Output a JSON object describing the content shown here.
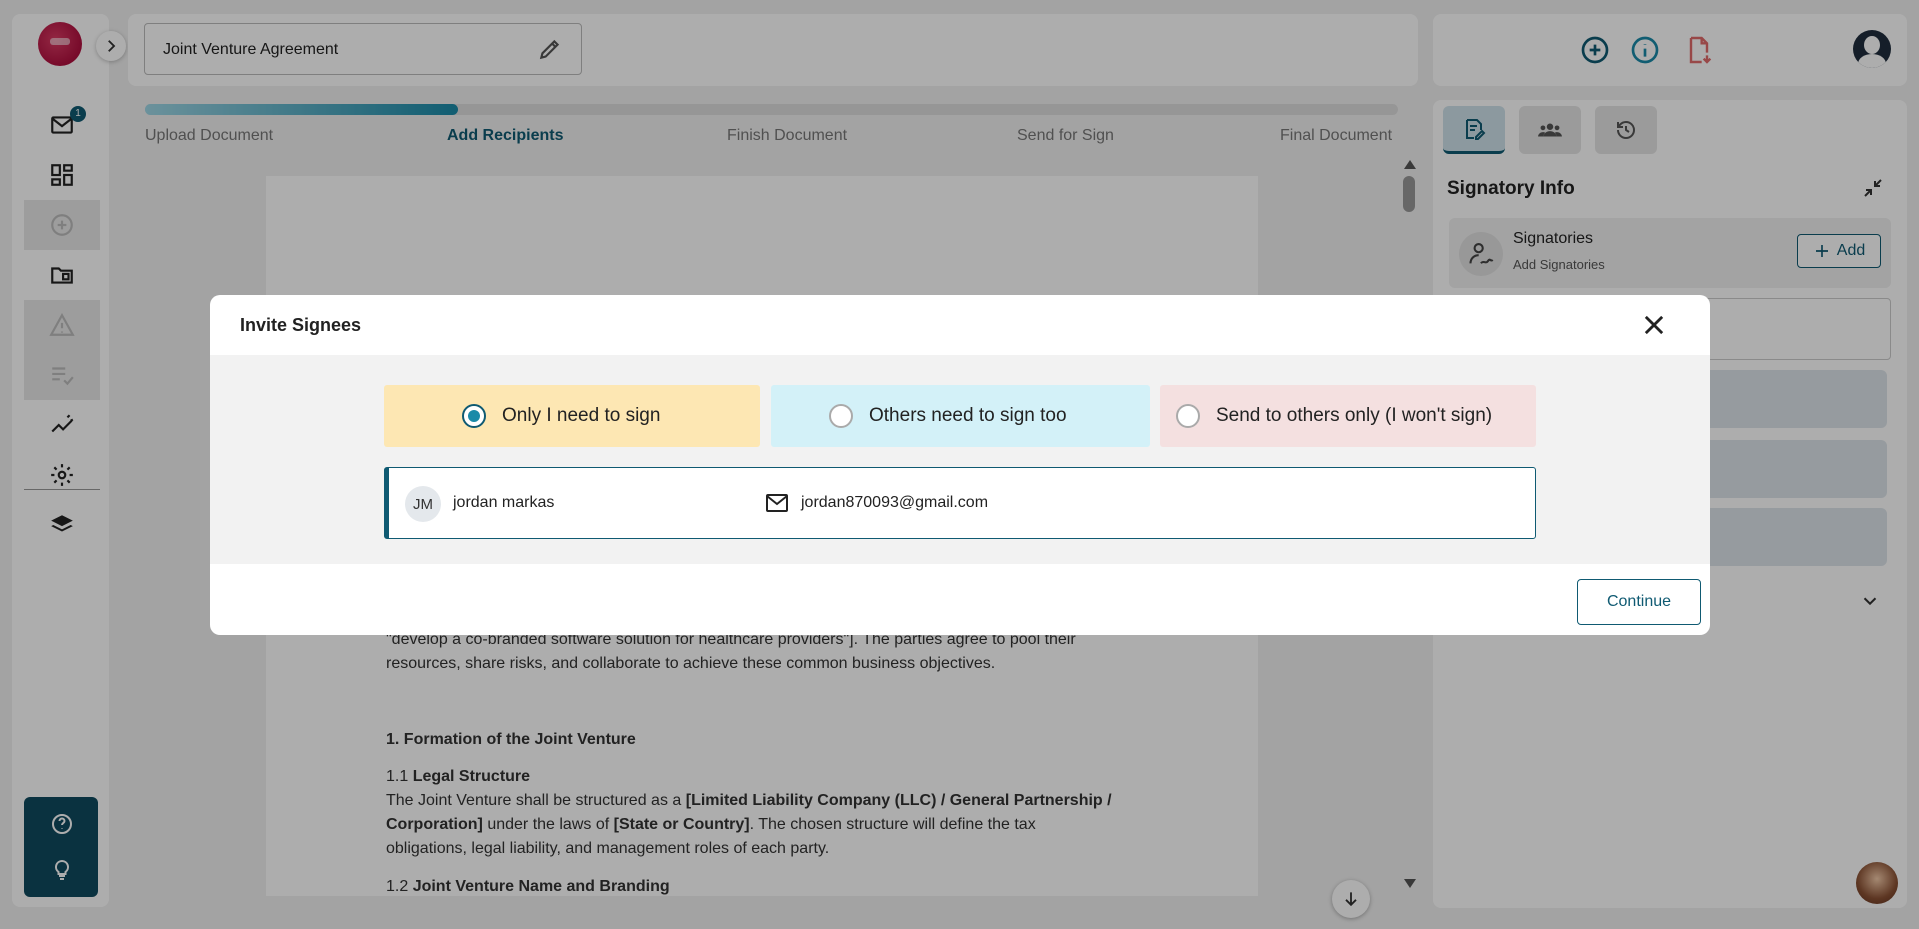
{
  "sidebar": {
    "badge_count": "1",
    "items": [
      {
        "icon": "mail-icon"
      },
      {
        "icon": "dashboard-icon"
      },
      {
        "icon": "add-circle-icon"
      },
      {
        "icon": "folder-icon"
      },
      {
        "icon": "warning-icon"
      },
      {
        "icon": "checklist-icon"
      },
      {
        "icon": "analytics-icon"
      },
      {
        "icon": "settings-icon"
      },
      {
        "icon": "layers-icon"
      }
    ],
    "help_icons": [
      "help-icon",
      "lightbulb-icon"
    ]
  },
  "header": {
    "document_title": "Joint Venture Agreement"
  },
  "progress": {
    "fraction": 0.25,
    "steps": [
      {
        "label": "Upload Document"
      },
      {
        "label": "Add Recipients"
      },
      {
        "label": "Finish Document"
      },
      {
        "label": "Send for Sign"
      },
      {
        "label": "Final Document"
      }
    ],
    "active_step": 1
  },
  "document": {
    "para1_line1": "\"develop a co-branded software solution for healthcare providers\"]. The parties agree to pool their",
    "para1_line2": "resources, share risks, and collaborate to achieve these common business objectives.",
    "section1_heading": "1. Formation of the Joint Venture",
    "s11_number": "1.1 ",
    "s11_title": "Legal Structure",
    "s11_line1_pre": "The Joint Venture shall be structured as a ",
    "s11_line1_bold": "[Limited Liability Company (LLC) / General Partnership /",
    "s11_line2_bold": "Corporation]",
    "s11_line2_mid": " under the laws of ",
    "s11_line2_bold2": "[State or Country]",
    "s11_line2_post": ". The chosen structure will define the tax",
    "s11_line3": "obligations, legal liability, and management roles of each party.",
    "s12_number": "1.2 ",
    "s12_title": "Joint Venture Name and Branding"
  },
  "right_panel": {
    "title": "Signatory Info",
    "signatories_label": "Signatories",
    "signatories_sub": "Add Signatories",
    "add_label": "Add"
  },
  "modal": {
    "title": "Invite Signees",
    "options": [
      {
        "label": "Only I need to sign",
        "selected": true,
        "color": "#fde7b3"
      },
      {
        "label": "Others need to sign too",
        "selected": false,
        "color": "#d3f1f8"
      },
      {
        "label": "Send to others only (I won't sign)",
        "selected": false,
        "color": "#f4e0e0"
      }
    ],
    "signer": {
      "initials": "JM",
      "name": "jordan markas",
      "email": "jordan870093@gmail.com"
    },
    "continue_label": "Continue"
  },
  "colors": {
    "accent": "#0f5a72",
    "accent_light": "#1a8aa8"
  }
}
